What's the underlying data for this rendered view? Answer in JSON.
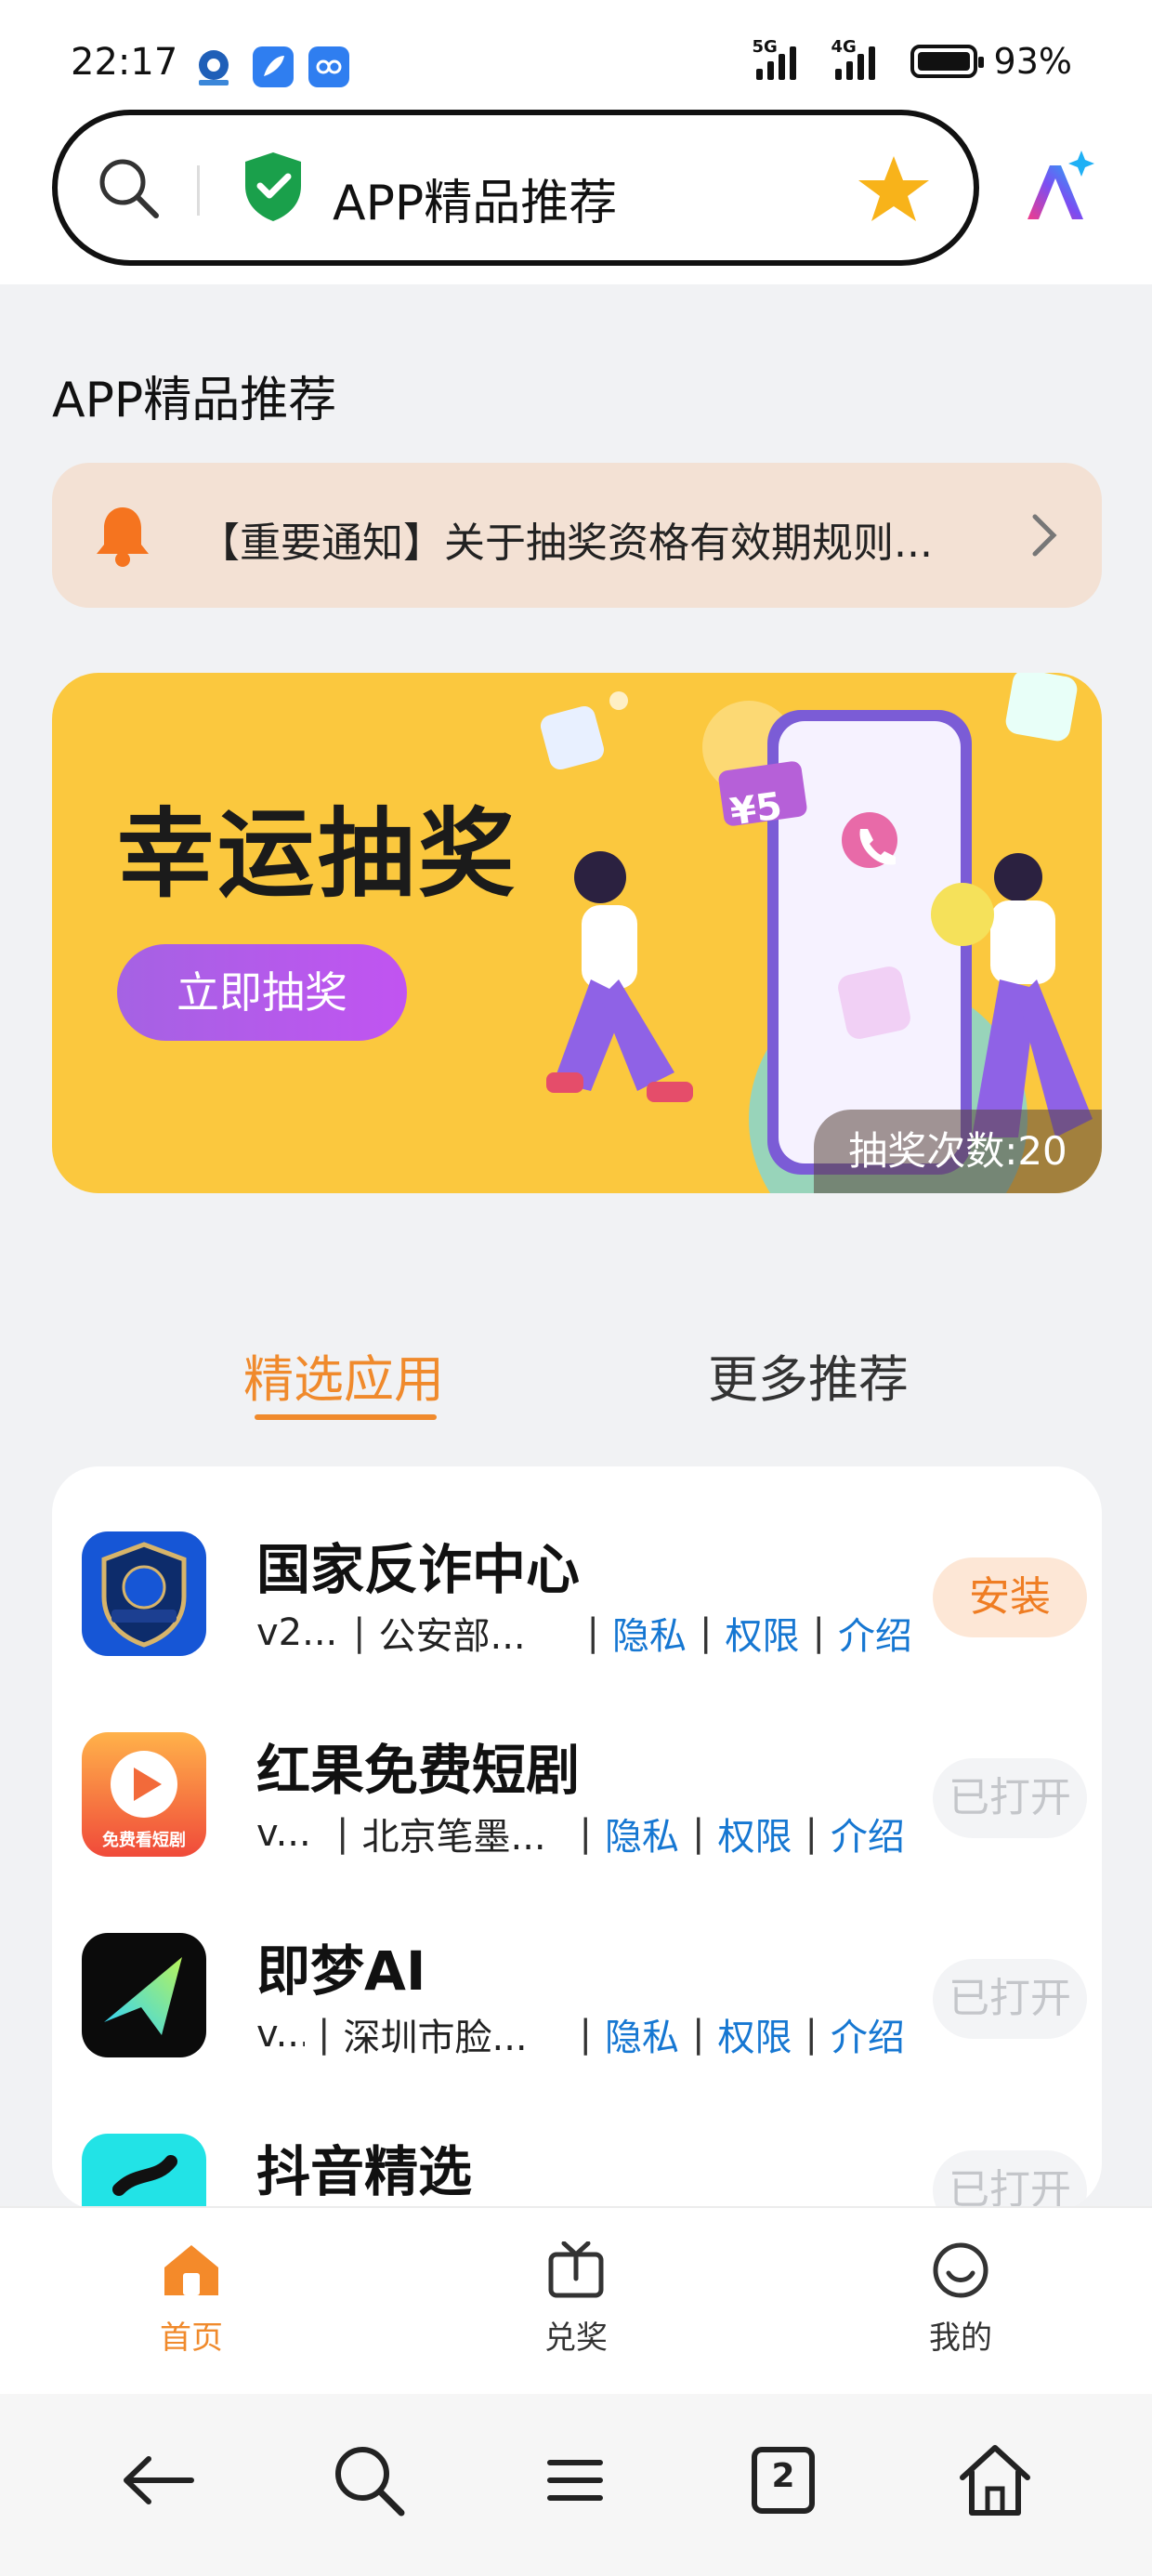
{
  "status_bar": {
    "time": "22:17",
    "battery": "93%",
    "signal_1_label": "5G",
    "signal_2_label": "4G"
  },
  "search_bar": {
    "title": "APP精品推荐"
  },
  "page": {
    "title": "APP精品推荐",
    "notice": "【重要通知】关于抽奖资格有效期规则..."
  },
  "banner": {
    "headline": "幸运抽奖",
    "button": "立即抽奖",
    "count_label": "抽奖次数:20",
    "coupon": "¥5"
  },
  "tabs": [
    {
      "label": "精选应用",
      "active": true
    },
    {
      "label": "更多推荐",
      "active": false
    }
  ],
  "apps": [
    {
      "name": "国家反诈中心",
      "version": "v2...",
      "developer": "公安部...",
      "privacy": "隐私",
      "permission": "权限",
      "intro": "介绍",
      "button": "安装",
      "icon_label": "国家反诈中心"
    },
    {
      "name": "红果免费短剧",
      "version": "v...",
      "developer": "北京笔墨...",
      "privacy": "隐私",
      "permission": "权限",
      "intro": "介绍",
      "button": "已打开",
      "icon_label": "免费看短剧"
    },
    {
      "name": "即梦AI",
      "version": "v...",
      "developer": "深圳市脸...",
      "privacy": "隐私",
      "permission": "权限",
      "intro": "介绍",
      "button": "已打开"
    },
    {
      "name": "抖音精选",
      "button": "已打开"
    }
  ],
  "tabbar": [
    {
      "label": "首页",
      "icon": "home-icon",
      "active": true
    },
    {
      "label": "兑奖",
      "icon": "gift-icon",
      "active": false
    },
    {
      "label": "我的",
      "icon": "smile-icon",
      "active": false
    }
  ],
  "system_nav": {
    "tab_count": "2"
  },
  "colors": {
    "accent": "#f08a2c",
    "link": "#1677d2",
    "banner": "#fbc83e",
    "notice_bg": "#f3e1d4",
    "purple_button": "#b35de9"
  }
}
